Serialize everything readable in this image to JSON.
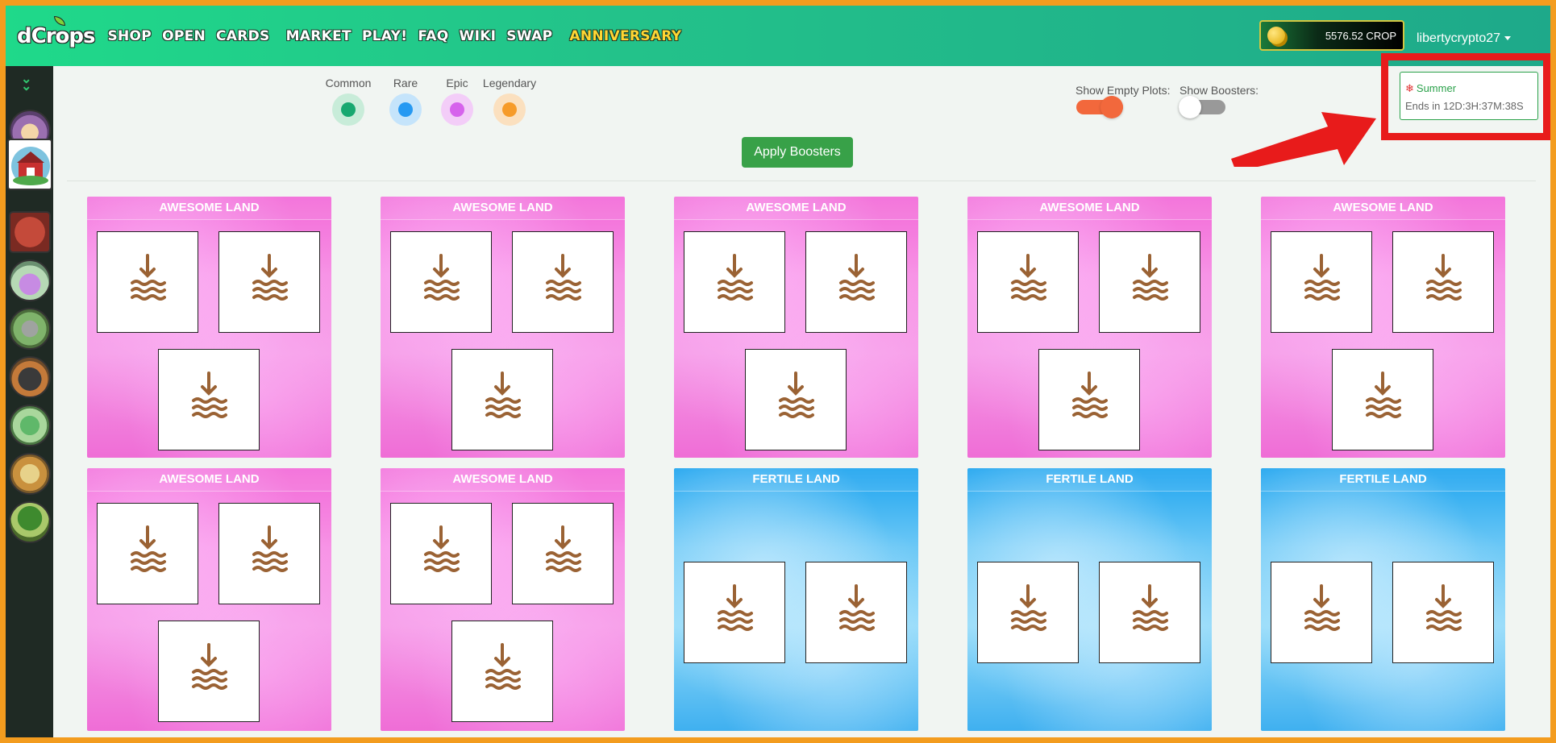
{
  "app": {
    "logo": "dCrops"
  },
  "nav": {
    "links": [
      "SHOP",
      "OPEN",
      "CARDS",
      "MARKET",
      "PLAY!",
      "FAQ",
      "WIKI",
      "SWAP",
      "ANNIVERSARY"
    ]
  },
  "header": {
    "balance": "5576.52 CROP",
    "username": "libertycrypto27"
  },
  "sidebar": {
    "icons": [
      "planting-icon",
      "farm-icon",
      "crates-icon",
      "potion-icon",
      "tools-icon",
      "anvil-icon",
      "jar-icon",
      "cooking-icon",
      "tree-icon"
    ],
    "active_index": 1
  },
  "rarity": [
    {
      "label": "Common",
      "color": "#17a870",
      "halo": "#c8ecd9"
    },
    {
      "label": "Rare",
      "color": "#2699f2",
      "halo": "#c5e4fb"
    },
    {
      "label": "Epic",
      "color": "#d662ec",
      "halo": "#f3cdf8"
    },
    {
      "label": "Legendary",
      "color": "#f69b2a",
      "halo": "#fbe0bf"
    }
  ],
  "toggles": {
    "empty_plots": {
      "label": "Show Empty Plots:",
      "on": true
    },
    "boosters": {
      "label": "Show Boosters:",
      "on": false
    }
  },
  "season": {
    "name": "Summer",
    "ends": "Ends in 12D:3H:37M:38S"
  },
  "apply_button": "Apply Boosters",
  "lands": [
    {
      "title": "AWESOME LAND",
      "type": "awesome",
      "plots": 3
    },
    {
      "title": "AWESOME LAND",
      "type": "awesome",
      "plots": 3
    },
    {
      "title": "AWESOME LAND",
      "type": "awesome",
      "plots": 3
    },
    {
      "title": "AWESOME LAND",
      "type": "awesome",
      "plots": 3
    },
    {
      "title": "AWESOME LAND",
      "type": "awesome",
      "plots": 3
    },
    {
      "title": "AWESOME LAND",
      "type": "awesome",
      "plots": 3
    },
    {
      "title": "AWESOME LAND",
      "type": "awesome",
      "plots": 3
    },
    {
      "title": "FERTILE LAND",
      "type": "fertile",
      "plots": 2
    },
    {
      "title": "FERTILE LAND",
      "type": "fertile",
      "plots": 2
    },
    {
      "title": "FERTILE LAND",
      "type": "fertile",
      "plots": 2
    }
  ]
}
